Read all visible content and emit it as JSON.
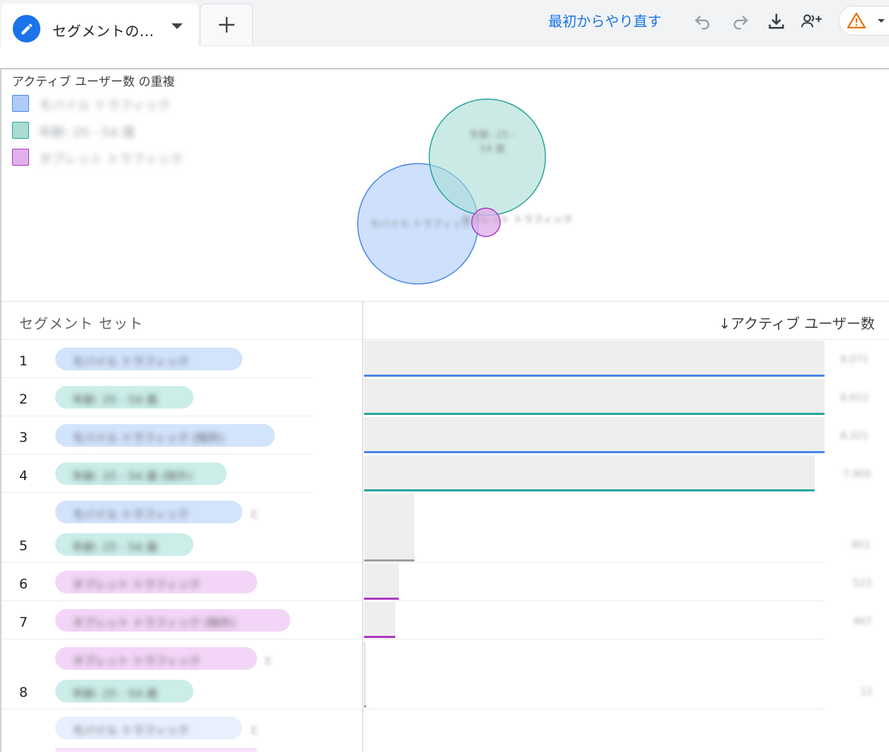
{
  "tabs": {
    "active_title": "セグメントの...",
    "add_symbol": "+"
  },
  "toolbar": {
    "restart_label": "最初からやり直す",
    "icons": [
      "undo-icon",
      "redo-icon",
      "download-icon",
      "share-users-icon",
      "warning-icon"
    ]
  },
  "venn": {
    "title": "アクティブ ユーザー数 の重複",
    "legend": [
      {
        "label": "モバイル トラフィック",
        "color": "#aecbfa"
      },
      {
        "label": "年齢: 25 - 54 歳",
        "color": "#a8dcd4"
      },
      {
        "label": "タブレット トラフィック",
        "color": "#e1b0ec"
      }
    ],
    "labels": {
      "circle_mobile": "モバイル トラフィック",
      "circle_age": "年齢: 25 - 54 歳",
      "circle_tablet": "タブレット トラフィック"
    }
  },
  "table": {
    "col_segment": "セグメント セット",
    "col_metric": "↓アクティブ ユーザー数",
    "rows": [
      {
        "num": "1",
        "chips": [
          "モバイル トラフィック"
        ],
        "value": "9,071"
      },
      {
        "num": "2",
        "chips": [
          "年齢: 25 - 54 歳"
        ],
        "value": "8,612"
      },
      {
        "num": "3",
        "chips": [
          "モバイル トラフィック (除外)"
        ],
        "value": "8,321"
      },
      {
        "num": "4",
        "chips": [
          "年齢: 25 - 54 歳 (除外)"
        ],
        "value": "7,905"
      },
      {
        "num": "5",
        "chips": [
          "モバイル トラフィック",
          "年齢: 25 - 54 歳"
        ],
        "and_label": "と",
        "value": "901"
      },
      {
        "num": "6",
        "chips": [
          "タブレット トラフィック"
        ],
        "value": "523"
      },
      {
        "num": "7",
        "chips": [
          "タブレット トラフィック (除外)"
        ],
        "value": "467"
      },
      {
        "num": "8",
        "chips": [
          "タブレット トラフィック",
          "年齢: 25 - 54 歳"
        ],
        "and_label": "と",
        "value": "12"
      },
      {
        "num": "",
        "chips": [
          "モバイル トラフィック"
        ],
        "and_label": "と",
        "value": ""
      }
    ]
  },
  "colors": {
    "blue": "#4a86e8",
    "teal": "#26a69a",
    "purple": "#aa37c2",
    "gray": "#9e9e9e",
    "accent": "#1a73e8"
  }
}
